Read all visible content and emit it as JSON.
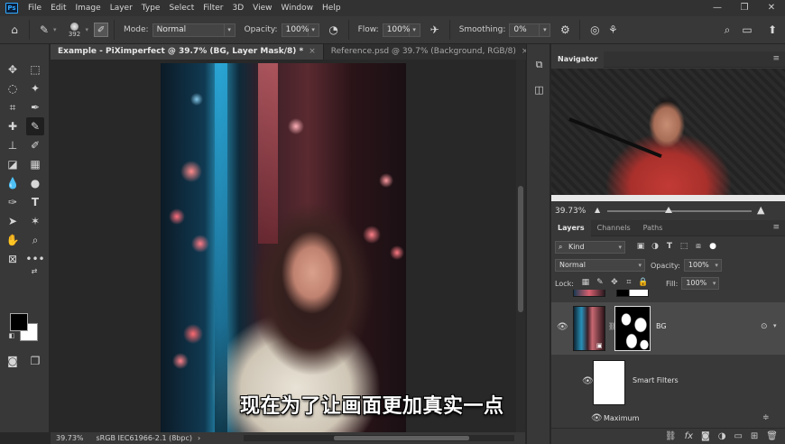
{
  "app": {
    "logo": "Ps"
  },
  "menu": [
    "File",
    "Edit",
    "Image",
    "Layer",
    "Type",
    "Select",
    "Filter",
    "3D",
    "View",
    "Window",
    "Help"
  ],
  "window_controls": [
    "—",
    "❐",
    "✕"
  ],
  "options": {
    "brush_size": "392",
    "mode_label": "Mode:",
    "mode_value": "Normal",
    "opacity_label": "Opacity:",
    "opacity_value": "100%",
    "flow_label": "Flow:",
    "flow_value": "100%",
    "smoothing_label": "Smoothing:",
    "smoothing_value": "0%"
  },
  "tabs": [
    {
      "label": "Example - PiXimperfect @ 39.7% (BG, Layer Mask/8) *",
      "active": true
    },
    {
      "label": "Reference.psd @ 39.7% (Background, RGB/8)",
      "active": false
    }
  ],
  "canvas": {
    "subtitle": "现在为了让画面更加真实一点"
  },
  "status": {
    "zoom": "39.73%",
    "profile": "sRGB IEC61966-2.1 (8bpc)"
  },
  "navigator": {
    "title": "Navigator",
    "zoom": "39.73%"
  },
  "layers_panel": {
    "tabs": [
      "Layers",
      "Channels",
      "Paths"
    ],
    "filter_kind": "Kind",
    "blend_mode": "Normal",
    "opacity_label": "Opacity:",
    "opacity_value": "100%",
    "lock_label": "Lock:",
    "fill_label": "Fill:",
    "fill_value": "100%",
    "layers": [
      {
        "name": "BG",
        "type": "smart object with mask"
      },
      {
        "name": "Smart Filters",
        "type": "filter mask"
      },
      {
        "name": "Maximum",
        "type": "filter"
      }
    ],
    "footer_icons": [
      "link-icon",
      "fx-icon",
      "mask-icon",
      "adjustment-icon",
      "folder-icon",
      "new-layer-icon",
      "trash-icon"
    ]
  },
  "colors": {
    "accent": "#31a8ff",
    "panel": "#383838",
    "app_bg": "#282828"
  }
}
